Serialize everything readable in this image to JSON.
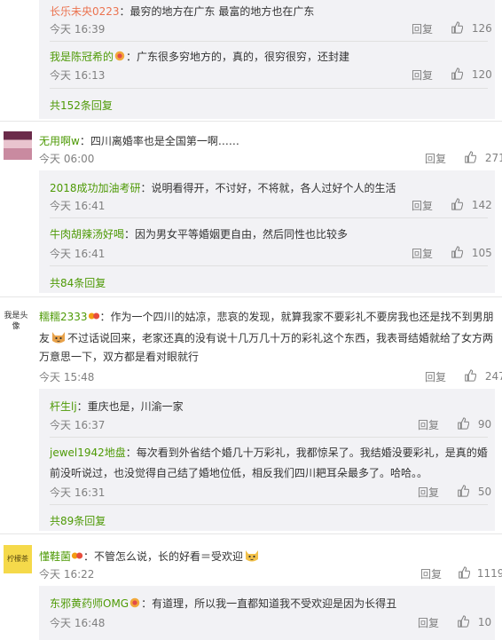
{
  "block1": {
    "sub1": {
      "user": "长乐未央0223",
      "text": "：最穷的地方在广东 最富的地方也在广东",
      "time": "今天 16:39",
      "reply": "回复",
      "likes": "126"
    },
    "sub2": {
      "user": "我是陈冠希的",
      "text": "：广东很多穷地方的，真的，很穷很穷，还封建",
      "time": "今天 16:13",
      "reply": "回复",
      "likes": "120"
    },
    "more": "共152条回复"
  },
  "c2": {
    "user": "无用啊w",
    "text": "：四川离婚率也是全国第一啊……",
    "time": "今天 06:00",
    "reply": "回复",
    "likes": "271",
    "sub1": {
      "user": "2018成功加油考研",
      "text": "：说明看得开，不讨好，不将就，各人过好个人的生活",
      "time": "今天 16:41",
      "reply": "回复",
      "likes": "142"
    },
    "sub2": {
      "user": "牛肉胡辣汤好喝",
      "text": "：因为男女平等婚姻更自由，然后同性也比较多",
      "time": "今天 16:41",
      "reply": "回复",
      "likes": "105"
    },
    "more": "共84条回复"
  },
  "c3": {
    "avatar": "我是头像",
    "user": "糯糯2333",
    "text_line1": "：作为一个四川的姑凉，悲哀的发现，就算我家不要彩礼不要房我也还是找不到男朋",
    "text_line2a": "友",
    "text_line2b": "不过话说回来，老家还真的没有说十几万几十万的彩礼这个东西，我表哥结婚就给了女方两",
    "text_line3": "万意思一下，双方都是看对眼就行",
    "time": "今天 15:48",
    "reply": "回复",
    "likes": "247",
    "sub1": {
      "user": "杆生lj",
      "text": "：重庆也是，川渝一家",
      "time": "今天 16:37",
      "reply": "回复",
      "likes": "90"
    },
    "sub2": {
      "user": "jewel1942地盘",
      "text_line1": "：每次看到外省结个婚几十万彩礼，我都惊呆了。我结婚没要彩礼，是真的婚",
      "text_line2": "前没听说过，也没觉得自己结了婚地位低，相反我们四川耙耳朵最多了。哈哈。。",
      "time": "今天 16:31",
      "reply": "回复",
      "likes": "50"
    },
    "more": "共89条回复"
  },
  "c4": {
    "avatar": "柠檬茶",
    "user": "懂鞋菌",
    "text": "：不管怎么说，长的好看＝受欢迎",
    "time": "今天 16:22",
    "reply": "回复",
    "likes": "1119",
    "sub1": {
      "user": "东邪黄药师OMG",
      "text": "：有道理，所以我一直都知道我不受欢迎是因为长得丑",
      "time": "今天 16:48",
      "reply": "回复",
      "likes": "10"
    }
  }
}
